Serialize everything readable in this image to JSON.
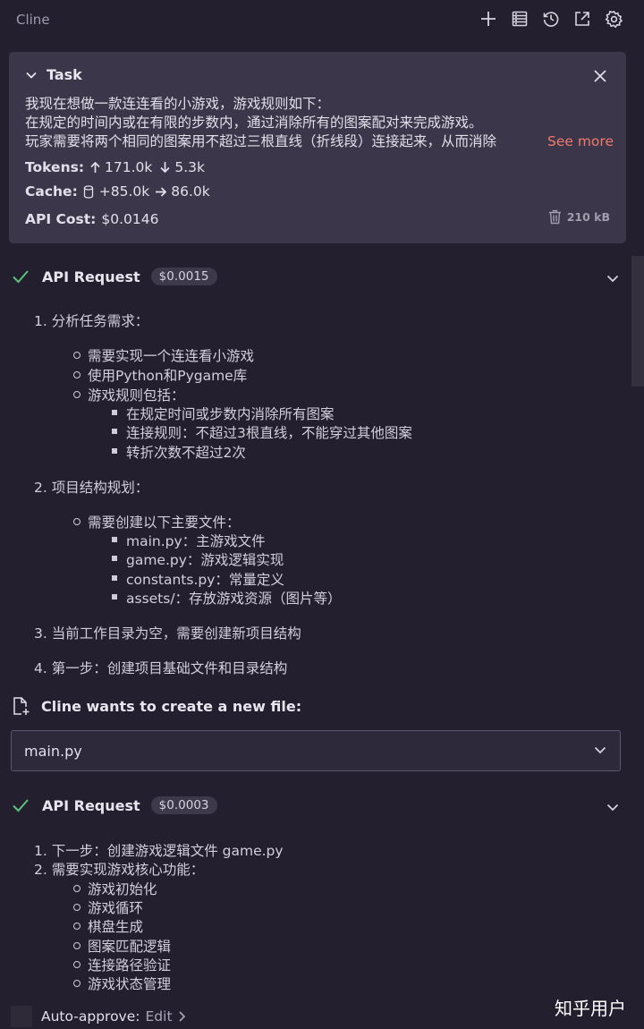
{
  "app": {
    "title": "Cline"
  },
  "toolbar": {
    "icons": [
      "plus-icon",
      "history-list-icon",
      "history-clock-icon",
      "external-link-icon",
      "gear-icon"
    ]
  },
  "task": {
    "label": "Task",
    "lines": [
      "我现在想做一款连连看的小游戏，游戏规则如下：",
      "在规定的时间内或在有限的步数内，通过消除所有的图案配对来完成游戏。",
      "玩家需要将两个相同的图案用不超过三根直线（折线段）连接起来，从而消除"
    ],
    "see_more": "See more",
    "tokens_label": "Tokens:",
    "tokens_in": "171.0k",
    "tokens_out": "5.3k",
    "cache_label": "Cache:",
    "cache_write": "+85.0k",
    "cache_read": "86.0k",
    "api_cost_label": "API Cost:",
    "api_cost": "$0.0146",
    "size": "210 kB"
  },
  "request1": {
    "title": "API Request",
    "cost": "$0.0015",
    "items": {
      "i1": "1. 分析任务需求：",
      "i1a": "需要实现一个连连看小游戏",
      "i1b": "使用Python和Pygame库",
      "i1c": "游戏规则包括：",
      "i1c1": "在规定时间或步数内消除所有图案",
      "i1c2": "连接规则：不超过3根直线，不能穿过其他图案",
      "i1c3": "转折次数不超过2次",
      "i2": "2. 项目结构规划：",
      "i2a": "需要创建以下主要文件：",
      "i2a1": "main.py：主游戏文件",
      "i2a2": "game.py：游戏逻辑实现",
      "i2a3": "constants.py：常量定义",
      "i2a4": "assets/：存放游戏资源（图片等）",
      "i3": "3. 当前工作目录为空，需要创建新项目结构",
      "i4": "4. 第一步：创建项目基础文件和目录结构"
    }
  },
  "create_file": {
    "label": "Cline wants to create a new file:",
    "filename": "main.py"
  },
  "request2": {
    "title": "API Request",
    "cost": "$0.0003",
    "items": {
      "i1": "1. 下一步：创建游戏逻辑文件 game.py",
      "i2": "2. 需要实现游戏核心功能：",
      "i2a": "游戏初始化",
      "i2b": "游戏循环",
      "i2c": "棋盘生成",
      "i2d": "图案匹配逻辑",
      "i2e": "连接路径验证",
      "i2f": "游戏状态管理"
    }
  },
  "auto_approve": {
    "label": "Auto-approve:",
    "edit": "Edit"
  },
  "watermark": "知乎用户",
  "colors": {
    "background": "#231f2e",
    "card": "#3b3649",
    "success": "#5ec27a",
    "link": "#f07a6c"
  }
}
